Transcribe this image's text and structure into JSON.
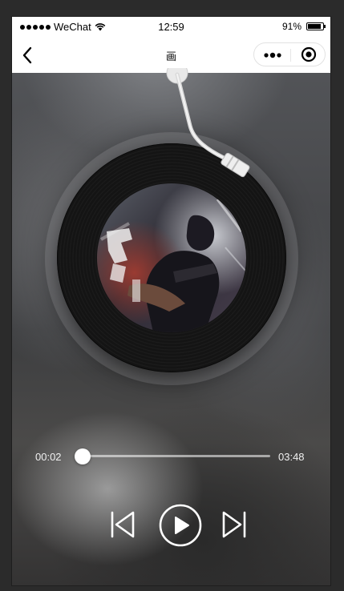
{
  "status_bar": {
    "carrier": "WeChat",
    "time": "12:59",
    "battery_text": "91%",
    "battery_level": 0.91
  },
  "nav": {
    "title": "画",
    "back_icon": "chevron-left-icon",
    "more_icon": "more-dots-icon",
    "close_icon": "target-circle-icon"
  },
  "player": {
    "current_time": "00:02",
    "total_time": "03:48",
    "progress": 0.01,
    "play_icon": "play-icon",
    "prev_icon": "skip-previous-icon",
    "next_icon": "skip-next-icon"
  },
  "colors": {
    "accent": "#ffffff",
    "vinyl": "#141414",
    "bar_bg": "#ffffff"
  }
}
